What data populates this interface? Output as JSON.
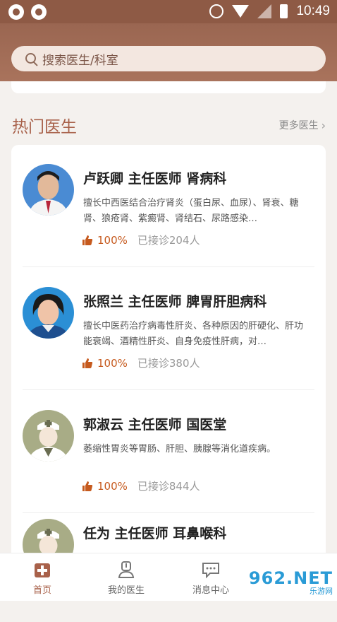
{
  "status_bar": {
    "time": "10:49"
  },
  "search": {
    "placeholder": "搜索医生/科室"
  },
  "section": {
    "title": "热门医生",
    "more": "更多医生"
  },
  "doctors": [
    {
      "name": "卢跃卿 主任医师 肾病科",
      "desc": "擅长中西医结合治疗肾炎（蛋白尿、血尿）、肾衰、糖肾、狼疮肾、紫癜肾、肾结石、尿路感染…",
      "rate": "100%",
      "consults": "已接诊204人",
      "avatar": "photo-male"
    },
    {
      "name": "张照兰 主任医师 脾胃肝胆病科",
      "desc": "擅长中医药治疗病毒性肝炎、各种原因的肝硬化、肝功能衰竭、酒精性肝炎、自身免疫性肝病，对…",
      "rate": "100%",
      "consults": "已接诊380人",
      "avatar": "photo-female"
    },
    {
      "name": "郭淑云 主任医师 国医堂",
      "desc": "萎缩性胃炎等胃肠、肝胆、胰腺等消化道疾病。",
      "rate": "100%",
      "consults": "已接诊844人",
      "avatar": "placeholder-doctor"
    },
    {
      "name": "任为 主任医师 耳鼻喉科",
      "desc": "",
      "rate": "",
      "consults": "",
      "avatar": "placeholder-doctor"
    }
  ],
  "tabs": [
    {
      "label": "首页",
      "icon": "home-plus-icon",
      "active": true
    },
    {
      "label": "我的医生",
      "icon": "doctor-icon",
      "active": false
    },
    {
      "label": "消息中心",
      "icon": "chat-icon",
      "active": false
    }
  ],
  "watermark": {
    "text": "962.NET",
    "sub": "乐游网"
  },
  "colors": {
    "brand": "#a8614a",
    "header": "#9a6651",
    "rate": "#c65a1e"
  }
}
